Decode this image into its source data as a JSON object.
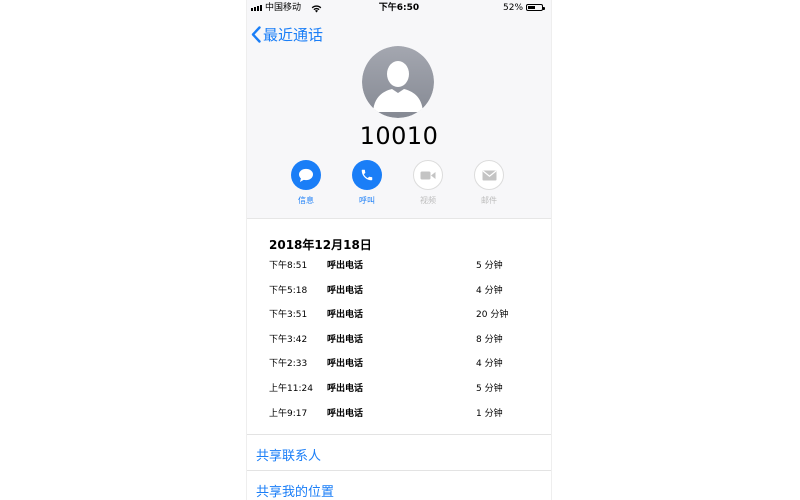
{
  "status": {
    "carrier": "中国移动",
    "time": "下午6:50",
    "battery_text": "52%",
    "battery_level": 0.52
  },
  "nav": {
    "back_label": "最近通话"
  },
  "contact": {
    "number": "10010"
  },
  "actions": [
    {
      "label": "信息",
      "icon": "message-icon",
      "enabled": true
    },
    {
      "label": "呼叫",
      "icon": "phone-icon",
      "enabled": true
    },
    {
      "label": "视频",
      "icon": "video-icon",
      "enabled": false
    },
    {
      "label": "邮件",
      "icon": "mail-icon",
      "enabled": false
    }
  ],
  "history": {
    "date": "2018年12月18日",
    "calls": [
      {
        "time": "下午8:51",
        "type": "呼出电话",
        "duration": "5 分钟"
      },
      {
        "time": "下午5:18",
        "type": "呼出电话",
        "duration": "4 分钟"
      },
      {
        "time": "下午3:51",
        "type": "呼出电话",
        "duration": "20 分钟"
      },
      {
        "time": "下午3:42",
        "type": "呼出电话",
        "duration": "8 分钟"
      },
      {
        "time": "下午2:33",
        "type": "呼出电话",
        "duration": "4 分钟"
      },
      {
        "time": "上午11:24",
        "type": "呼出电话",
        "duration": "5 分钟"
      },
      {
        "time": "上午9:17",
        "type": "呼出电话",
        "duration": "1 分钟"
      }
    ]
  },
  "links": {
    "share_contact": "共享联系人",
    "share_location": "共享我的位置"
  },
  "colors": {
    "accent": "#1a7ef7",
    "header_bg": "#f7f7f9",
    "disabled": "#bdbdbd"
  }
}
